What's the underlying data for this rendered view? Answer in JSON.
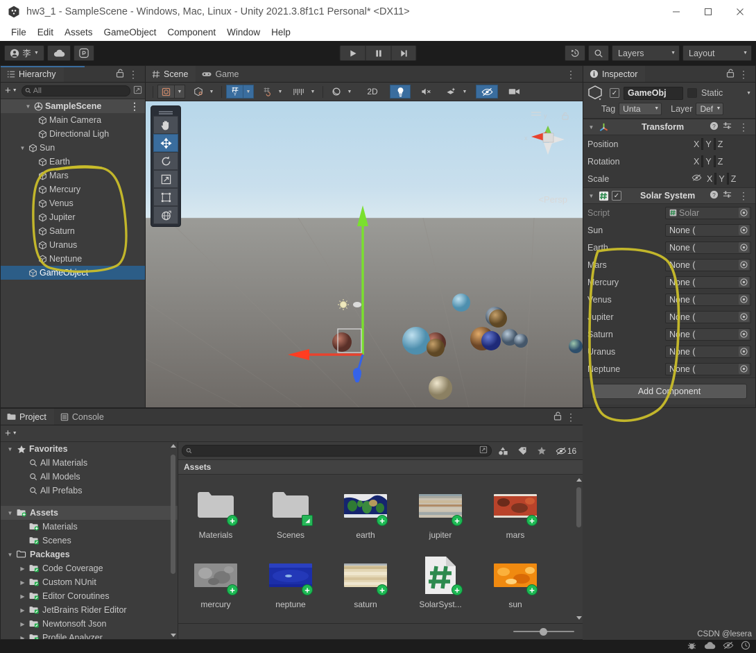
{
  "window": {
    "title": "hw3_1 - SampleScene - Windows, Mac, Linux - Unity 2021.3.8f1c1 Personal* <DX11>",
    "app_icon": "unity-icon",
    "minimize": "—",
    "maximize": "□",
    "close": "✕"
  },
  "menubar": {
    "items": [
      "File",
      "Edit",
      "Assets",
      "GameObject",
      "Component",
      "Window",
      "Help"
    ]
  },
  "toolbar": {
    "account_label": "李",
    "account_icon": "account-icon",
    "cloud_icon": "cloud-icon",
    "services_icon": "services-icon",
    "play_icon": "play-icon",
    "pause_icon": "pause-icon",
    "step_icon": "step-icon",
    "history_icon": "undo-history-icon",
    "search_icon": "search-icon",
    "layers_label": "Layers",
    "layout_label": "Layout"
  },
  "hierarchy": {
    "tab_label": "Hierarchy",
    "tab_icon": "hierarchy-icon",
    "lock_icon": "lock-open-icon",
    "menu_icon": "more-menu-icon",
    "add_label": "+",
    "search_placeholder": "All",
    "search_icon": "search-icon",
    "scene_name": "SampleScene",
    "scene_icon": "unity-scene-icon",
    "items": [
      {
        "label": "Main Camera",
        "depth": 2,
        "expandable": false,
        "selected": false
      },
      {
        "label": "Directional Ligh",
        "depth": 2,
        "expandable": false,
        "selected": false
      },
      {
        "label": "Sun",
        "depth": 1,
        "expandable": true,
        "selected": false
      },
      {
        "label": "Earth",
        "depth": 2,
        "expandable": false,
        "selected": false
      },
      {
        "label": "Mars",
        "depth": 2,
        "expandable": false,
        "selected": false
      },
      {
        "label": "Mercury",
        "depth": 2,
        "expandable": false,
        "selected": false
      },
      {
        "label": "Venus",
        "depth": 2,
        "expandable": false,
        "selected": false
      },
      {
        "label": "Jupiter",
        "depth": 2,
        "expandable": false,
        "selected": false
      },
      {
        "label": "Saturn",
        "depth": 2,
        "expandable": false,
        "selected": false
      },
      {
        "label": "Uranus",
        "depth": 2,
        "expandable": false,
        "selected": false
      },
      {
        "label": "Neptune",
        "depth": 2,
        "expandable": false,
        "selected": false
      },
      {
        "label": "GameObject",
        "depth": 1,
        "expandable": false,
        "selected": true
      }
    ]
  },
  "scene": {
    "tabs": [
      {
        "label": "Scene",
        "icon": "scene-grid-icon",
        "active": true
      },
      {
        "label": "Game",
        "icon": "gamepad-icon",
        "active": false
      }
    ],
    "menu_icon": "more-menu-icon",
    "toolbar_buttons": [
      {
        "name": "draw-mode-shaded",
        "icon": "shaded-icon",
        "active": false,
        "caret": true
      },
      {
        "name": "scene-camera-2d3d",
        "icon": "cube-wire-icon",
        "active": false,
        "caret": true
      },
      {
        "name": "grid-visibility",
        "icon": "grid-y-icon",
        "active": true,
        "caret": true
      },
      {
        "name": "grid-snapping",
        "icon": "grid-snap-icon",
        "active": false,
        "caret": true
      },
      {
        "name": "grid-increment",
        "icon": "ruler-icon",
        "active": false,
        "caret": true
      },
      {
        "name": "scene-lighting-mode",
        "icon": "sphere-icon",
        "active": false,
        "caret": true
      },
      {
        "name": "toggle-2d",
        "icon": "2D",
        "active": false,
        "caret": false
      },
      {
        "name": "scene-lighting",
        "icon": "bulb-icon",
        "active": true,
        "caret": false
      },
      {
        "name": "scene-audio",
        "icon": "audio-mute-icon",
        "active": false,
        "caret": false
      },
      {
        "name": "scene-fx",
        "icon": "fx-icon",
        "active": false,
        "caret": true
      },
      {
        "name": "scene-visibility",
        "icon": "eye-off-icon",
        "active": true,
        "caret": false
      },
      {
        "name": "scene-camera",
        "icon": "camera-icon",
        "active": false,
        "caret": false
      }
    ],
    "tools": [
      {
        "name": "hand-tool",
        "icon": "hand-icon",
        "active": false
      },
      {
        "name": "move-tool",
        "icon": "move-icon",
        "active": true
      },
      {
        "name": "rotate-tool",
        "icon": "rotate-icon",
        "active": false
      },
      {
        "name": "scale-tool",
        "icon": "scale-icon",
        "active": false
      },
      {
        "name": "rect-tool",
        "icon": "rect-icon",
        "active": false
      },
      {
        "name": "transform-tool",
        "icon": "transform-icon",
        "active": false
      }
    ],
    "gizmo": {
      "x_label": "x",
      "y_label": "y",
      "lock_icon": "lock-open-icon"
    },
    "persp_label": "Persp",
    "persp_caret": "<"
  },
  "inspector": {
    "tab_label": "Inspector",
    "tab_icon": "info-icon",
    "lock_icon": "lock-open-icon",
    "menu_icon": "more-menu-icon",
    "object_icon": "cube-icon",
    "enabled_checked": true,
    "object_name": "GameObj",
    "static_label": "Static",
    "static_checked": false,
    "tag_label": "Tag",
    "tag_value": "Unta",
    "layer_label": "Layer",
    "layer_value": "Def",
    "components": [
      {
        "title": "Transform",
        "icon": "transform-axis-icon",
        "has_checkbox": false,
        "help_icon": "help-icon",
        "preset_icon": "preset-icon",
        "menu_icon": "more-menu-icon",
        "rows": [
          {
            "label": "Position",
            "type": "vector3",
            "axes": [
              "X",
              "Y",
              "Z"
            ]
          },
          {
            "label": "Rotation",
            "type": "vector3",
            "axes": [
              "X",
              "Y",
              "Z"
            ]
          },
          {
            "label": "Scale",
            "type": "vector3",
            "axes": [
              "X",
              "Y",
              "Z"
            ],
            "link_icon": "link-off-icon"
          }
        ]
      },
      {
        "title": "Solar System",
        "icon": "csharp-script-icon",
        "has_checkbox": true,
        "checked": true,
        "help_icon": "help-icon",
        "preset_icon": "preset-icon",
        "menu_icon": "more-menu-icon",
        "rows": [
          {
            "label": "Script",
            "type": "object",
            "value": "Solar",
            "dim": true,
            "value_icon": "csharp-script-icon"
          },
          {
            "label": "Sun",
            "type": "object",
            "value": "None ("
          },
          {
            "label": "Earth",
            "type": "object",
            "value": "None ("
          },
          {
            "label": "Mars",
            "type": "object",
            "value": "None ("
          },
          {
            "label": "Mercury",
            "type": "object",
            "value": "None ("
          },
          {
            "label": "Venus",
            "type": "object",
            "value": "None ("
          },
          {
            "label": "Jupiter",
            "type": "object",
            "value": "None ("
          },
          {
            "label": "Saturn",
            "type": "object",
            "value": "None ("
          },
          {
            "label": "Uranus",
            "type": "object",
            "value": "None ("
          },
          {
            "label": "Neptune",
            "type": "object",
            "value": "None ("
          }
        ]
      }
    ],
    "add_component_label": "Add Component"
  },
  "project": {
    "tabs": [
      {
        "label": "Project",
        "icon": "folder-icon",
        "active": true
      },
      {
        "label": "Console",
        "icon": "console-icon",
        "active": false
      }
    ],
    "lock_icon": "lock-open-icon",
    "menu_icon": "more-menu-icon",
    "add_label": "+",
    "search_placeholder": "",
    "search_icon": "search-icon",
    "filter_buttons": [
      {
        "name": "filter-by-type",
        "icon": "shapes-icon"
      },
      {
        "name": "filter-by-label",
        "icon": "tag-icon"
      },
      {
        "name": "filter-favorites",
        "icon": "star-icon"
      },
      {
        "name": "scene-visibility-count",
        "icon": "eye-off-icon",
        "text": "16"
      }
    ],
    "tree": [
      {
        "label": "Favorites",
        "depth": 0,
        "icon": "star-icon",
        "bold": true,
        "tri": "down"
      },
      {
        "label": "All Materials",
        "depth": 1,
        "icon": "search-icon",
        "bold": false,
        "tri": ""
      },
      {
        "label": "All Models",
        "depth": 1,
        "icon": "search-icon",
        "bold": false,
        "tri": ""
      },
      {
        "label": "All Prefabs",
        "depth": 1,
        "icon": "search-icon",
        "bold": false,
        "tri": ""
      },
      {
        "label": "",
        "depth": 0,
        "icon": "",
        "bold": false,
        "tri": ""
      },
      {
        "label": "Assets",
        "depth": 0,
        "icon": "folder-add-icon",
        "bold": true,
        "tri": "down",
        "selected": true
      },
      {
        "label": "Materials",
        "depth": 1,
        "icon": "folder-add-icon",
        "bold": false,
        "tri": ""
      },
      {
        "label": "Scenes",
        "depth": 1,
        "icon": "folder-edit-icon",
        "bold": false,
        "tri": ""
      },
      {
        "label": "Packages",
        "depth": 0,
        "icon": "folder-plain-icon",
        "bold": true,
        "tri": "down"
      },
      {
        "label": "Code Coverage",
        "depth": 1,
        "icon": "folder-edit-icon",
        "bold": false,
        "tri": "right"
      },
      {
        "label": "Custom NUnit",
        "depth": 1,
        "icon": "folder-edit-icon",
        "bold": false,
        "tri": "right"
      },
      {
        "label": "Editor Coroutines",
        "depth": 1,
        "icon": "folder-edit-icon",
        "bold": false,
        "tri": "right"
      },
      {
        "label": "JetBrains Rider Editor",
        "depth": 1,
        "icon": "folder-edit-icon",
        "bold": false,
        "tri": "right"
      },
      {
        "label": "Newtonsoft Json",
        "depth": 1,
        "icon": "folder-edit-icon",
        "bold": false,
        "tri": "right"
      },
      {
        "label": "Profile Analyzer",
        "depth": 1,
        "icon": "folder-edit-icon",
        "bold": false,
        "tri": "right"
      }
    ],
    "breadcrumb": "Assets",
    "assets": [
      {
        "label": "Materials",
        "kind": "folder",
        "badge": "plus"
      },
      {
        "label": "Scenes",
        "kind": "folder",
        "badge": "edit"
      },
      {
        "label": "earth",
        "kind": "texture-earth",
        "badge": "plus"
      },
      {
        "label": "jupiter",
        "kind": "texture-jupiter",
        "badge": "plus"
      },
      {
        "label": "mars",
        "kind": "texture-mars",
        "badge": "plus"
      },
      {
        "label": "mercury",
        "kind": "texture-mercury",
        "badge": "plus"
      },
      {
        "label": "neptune",
        "kind": "texture-neptune",
        "badge": "plus"
      },
      {
        "label": "saturn",
        "kind": "texture-saturn",
        "badge": "plus"
      },
      {
        "label": "SolarSyst...",
        "kind": "script",
        "badge": "plus"
      },
      {
        "label": "sun",
        "kind": "texture-sun",
        "badge": "plus"
      }
    ]
  },
  "statusbar": {
    "watermark": "CSDN @lesera",
    "icons": [
      "bug-icon",
      "cloud-icon",
      "eye-off-icon",
      "progress-icon"
    ]
  },
  "annotations": {
    "color": "#c9bd2a",
    "shapes": [
      "hierarchy-circle",
      "inspector-circle"
    ]
  }
}
